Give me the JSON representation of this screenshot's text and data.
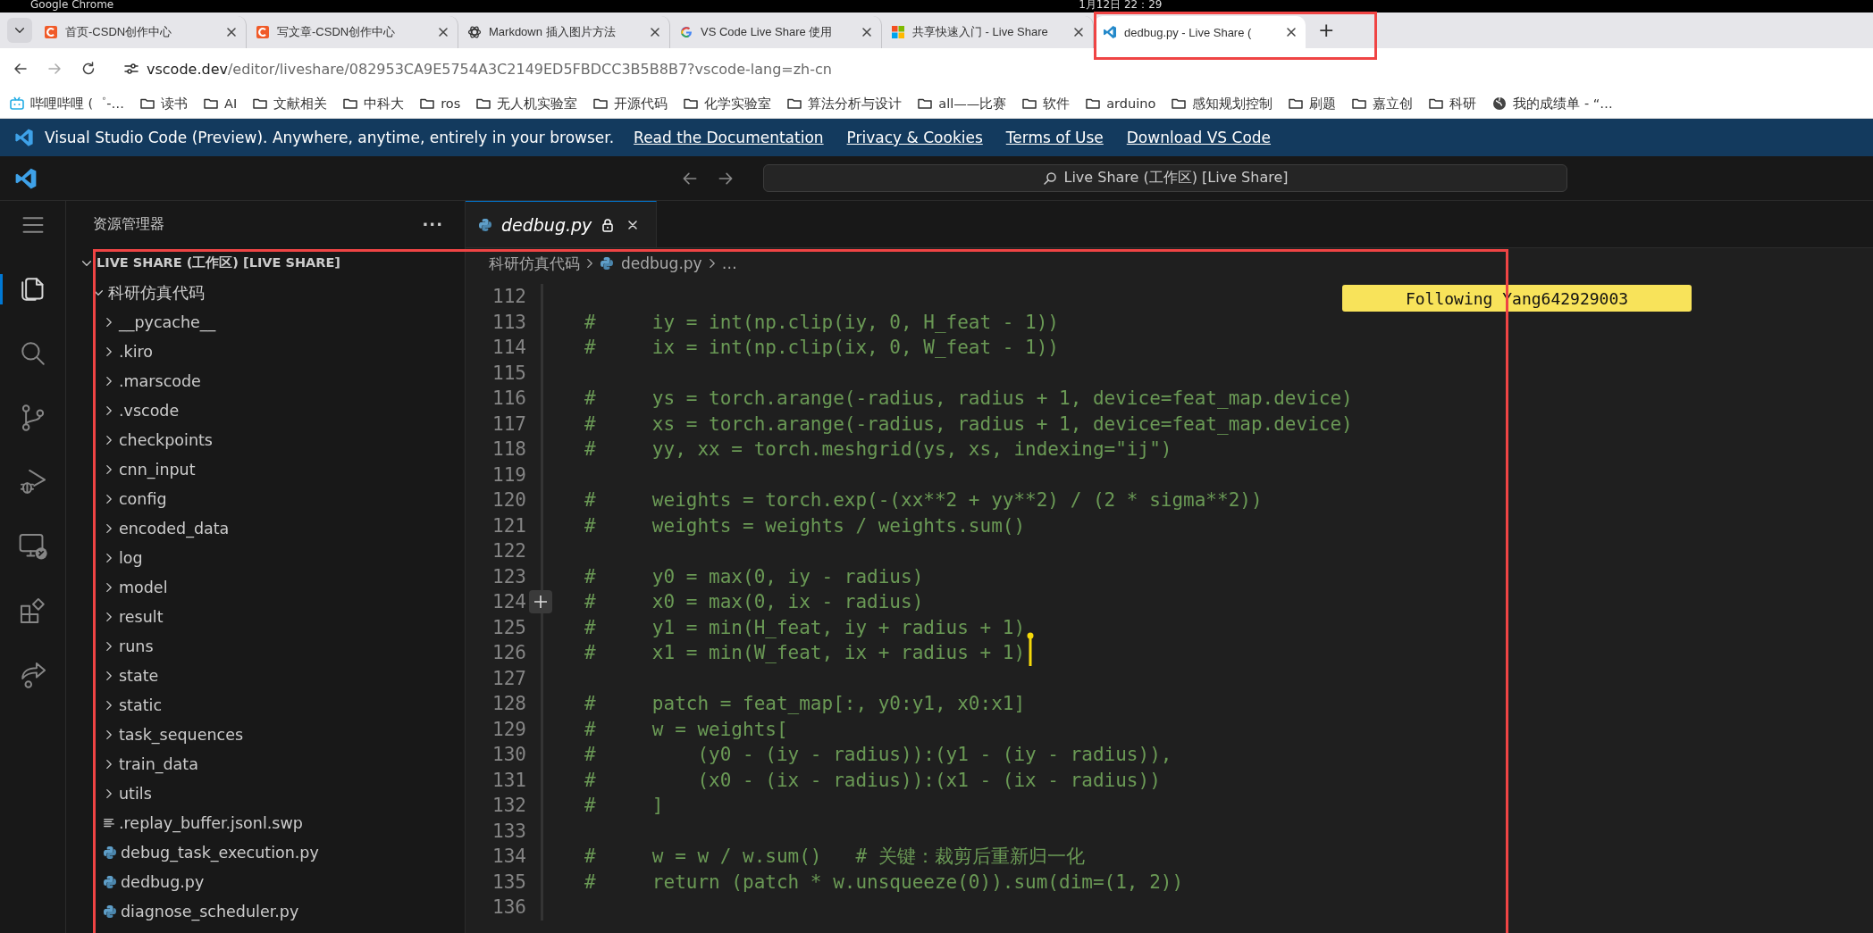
{
  "system_bar": {
    "app": "Google Chrome",
    "clock": "1月12日 22：29"
  },
  "browser_tabs": [
    {
      "title": "首页-CSDN创作中心",
      "kind": "arc",
      "selected": false
    },
    {
      "title": "写文章-CSDN创作中心",
      "kind": "arc",
      "selected": false
    },
    {
      "title": "Markdown 插入图片方法",
      "kind": "knot",
      "selected": false
    },
    {
      "title": "VS Code Live Share 使用",
      "kind": "ring",
      "selected": false
    },
    {
      "title": "共享快速入门 - Live Share",
      "kind": "squares",
      "selected": false
    },
    {
      "title": "dedbug.py - Live Share (",
      "kind": "code",
      "selected": true
    }
  ],
  "new_tab": "+",
  "address": {
    "host": "vscode.dev",
    "path": "/editor/liveshare/082953CA9E5754A3C2149ED5FBDCC3B5B8B7?vscode-lang=zh-cn"
  },
  "bookmarks": [
    {
      "label": "哔哩哔哩 (゜-…",
      "kind": "tv"
    },
    {
      "label": "读书",
      "kind": "folder"
    },
    {
      "label": "AI",
      "kind": "folder"
    },
    {
      "label": "文献相关",
      "kind": "folder"
    },
    {
      "label": "中科大",
      "kind": "folder"
    },
    {
      "label": "ros",
      "kind": "folder"
    },
    {
      "label": "无人机实验室",
      "kind": "folder"
    },
    {
      "label": "开源代码",
      "kind": "folder"
    },
    {
      "label": "化学实验室",
      "kind": "folder"
    },
    {
      "label": "算法分析与设计",
      "kind": "folder"
    },
    {
      "label": "all——比赛",
      "kind": "folder"
    },
    {
      "label": "软件",
      "kind": "folder"
    },
    {
      "label": "arduino",
      "kind": "folder"
    },
    {
      "label": "感知规划控制",
      "kind": "folder"
    },
    {
      "label": "刷题",
      "kind": "folder"
    },
    {
      "label": "嘉立创",
      "kind": "folder"
    },
    {
      "label": "科研",
      "kind": "folder"
    },
    {
      "label": "我的成绩单 - “…",
      "kind": "globe"
    }
  ],
  "banner": {
    "text": "Visual Studio Code (Preview). Anywhere, anytime, entirely in your browser.",
    "links": [
      "Read the Documentation",
      "Privacy & Cookies",
      "Terms of Use",
      "Download VS Code"
    ]
  },
  "command_center": "Live Share (工作区) [Live Share]",
  "activity_bar": [
    {
      "kind": "menu",
      "selected": false
    },
    {
      "kind": "explorer",
      "selected": true
    },
    {
      "kind": "search",
      "selected": false
    },
    {
      "kind": "source_control",
      "selected": false
    },
    {
      "kind": "run_debug",
      "selected": false
    },
    {
      "kind": "remote",
      "selected": false
    },
    {
      "kind": "extensions",
      "selected": false
    },
    {
      "kind": "live_share",
      "selected": false
    }
  ],
  "explorer": {
    "title": "资源管理器",
    "more": "···",
    "tree": [
      {
        "label": "LIVE SHARE (工作区) [LIVE SHARE]",
        "kind": "workspace",
        "expanded": true,
        "children": [
          {
            "label": "科研仿真代码",
            "kind": "folder",
            "expanded": true,
            "children": [
              {
                "label": "__pycache__",
                "kind": "folder",
                "expanded": false
              },
              {
                "label": ".kiro",
                "kind": "folder",
                "expanded": false
              },
              {
                "label": ".marscode",
                "kind": "folder",
                "expanded": false
              },
              {
                "label": ".vscode",
                "kind": "folder",
                "expanded": false
              },
              {
                "label": "checkpoints",
                "kind": "folder",
                "expanded": false
              },
              {
                "label": "cnn_input",
                "kind": "folder",
                "expanded": false
              },
              {
                "label": "config",
                "kind": "folder",
                "expanded": false
              },
              {
                "label": "encoded_data",
                "kind": "folder",
                "expanded": false
              },
              {
                "label": "log",
                "kind": "folder",
                "expanded": false
              },
              {
                "label": "model",
                "kind": "folder",
                "expanded": false
              },
              {
                "label": "result",
                "kind": "folder",
                "expanded": false
              },
              {
                "label": "runs",
                "kind": "folder",
                "expanded": false
              },
              {
                "label": "state",
                "kind": "folder",
                "expanded": false
              },
              {
                "label": "static",
                "kind": "folder",
                "expanded": false
              },
              {
                "label": "task_sequences",
                "kind": "folder",
                "expanded": false
              },
              {
                "label": "train_data",
                "kind": "folder",
                "expanded": false
              },
              {
                "label": "utils",
                "kind": "folder",
                "expanded": false
              },
              {
                "label": ".replay_buffer.jsonl.swp",
                "kind": "text"
              },
              {
                "label": "debug_task_execution.py",
                "kind": "python"
              },
              {
                "label": "dedbug.py",
                "kind": "python"
              },
              {
                "label": "diagnose_scheduler.py",
                "kind": "python"
              }
            ]
          }
        ]
      }
    ]
  },
  "editor": {
    "tabs": [
      {
        "title": "dedbug.py",
        "read_only": true,
        "selected": true
      }
    ],
    "breadcrumbs": [
      {
        "label": "科研仿真代码",
        "kind": "folder"
      },
      {
        "label": "dedbug.py",
        "kind": "python"
      },
      {
        "label": "…",
        "kind": "more"
      }
    ],
    "follow_badge": "Following Yang642929003",
    "lines": [
      {
        "number": "112",
        "add_button": false,
        "cursor": false
      },
      {
        "number": "113",
        "text": "#     iy = int(np.clip(iy, 0, H_feat - 1))",
        "add_button": false,
        "cursor": false
      },
      {
        "number": "114",
        "text": "#     ix = int(np.clip(ix, 0, W_feat - 1))",
        "add_button": false,
        "cursor": false
      },
      {
        "number": "115",
        "add_button": false,
        "cursor": false
      },
      {
        "number": "116",
        "text": "#     ys = torch.arange(-radius, radius + 1, device=feat_map.device)",
        "add_button": false,
        "cursor": false
      },
      {
        "number": "117",
        "text": "#     xs = torch.arange(-radius, radius + 1, device=feat_map.device)",
        "add_button": false,
        "cursor": false
      },
      {
        "number": "118",
        "text": "#     yy, xx = torch.meshgrid(ys, xs, indexing=\"ij\")",
        "add_button": false,
        "cursor": false
      },
      {
        "number": "119",
        "add_button": false,
        "cursor": false
      },
      {
        "number": "120",
        "text": "#     weights = torch.exp(-(xx**2 + yy**2) / (2 * sigma**2))",
        "add_button": false,
        "cursor": false
      },
      {
        "number": "121",
        "text": "#     weights = weights / weights.sum()",
        "add_button": false,
        "cursor": false
      },
      {
        "number": "122",
        "add_button": false,
        "cursor": false
      },
      {
        "number": "123",
        "text": "#     y0 = max(0, iy - radius)",
        "add_button": false,
        "cursor": false
      },
      {
        "number": "124",
        "text": "#     x0 = max(0, ix - radius)",
        "add_button": true,
        "cursor": false
      },
      {
        "number": "125",
        "text": "#     y1 = min(H_feat, iy + radius + 1)",
        "add_button": false,
        "cursor": false
      },
      {
        "number": "126",
        "text": "#     x1 = min(W_feat, ix + radius + 1)",
        "add_button": false,
        "cursor": true
      },
      {
        "number": "127",
        "add_button": false,
        "cursor": false
      },
      {
        "number": "128",
        "text": "#     patch = feat_map[:, y0:y1, x0:x1]",
        "add_button": false,
        "cursor": false
      },
      {
        "number": "129",
        "text": "#     w = weights[",
        "add_button": false,
        "cursor": false
      },
      {
        "number": "130",
        "text": "#         (y0 - (iy - radius)):(y1 - (iy - radius)),",
        "add_button": false,
        "cursor": false
      },
      {
        "number": "131",
        "text": "#         (x0 - (ix - radius)):(x1 - (ix - radius))",
        "add_button": false,
        "cursor": false
      },
      {
        "number": "132",
        "text": "#     ]",
        "add_button": false,
        "cursor": false
      },
      {
        "number": "133",
        "add_button": false,
        "cursor": false
      },
      {
        "number": "134",
        "text": "#     w = w / w.sum()   # 关键：裁剪后重新归一化",
        "add_button": false,
        "cursor": false
      },
      {
        "number": "135",
        "text": "#     return (patch * w.unsqueeze(0)).sum(dim=(1, 2))",
        "add_button": false,
        "cursor": false
      },
      {
        "number": "136",
        "add_button": false,
        "cursor": false
      }
    ]
  }
}
